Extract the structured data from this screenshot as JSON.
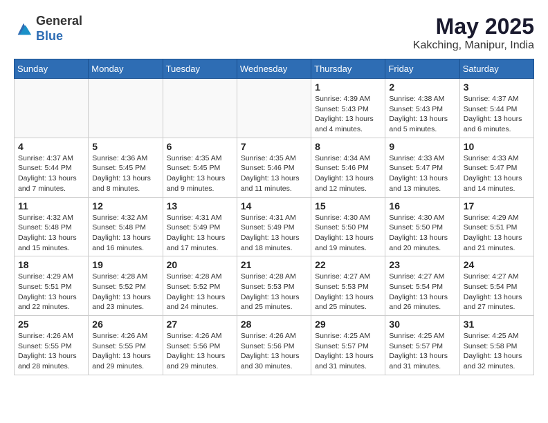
{
  "header": {
    "logo_general": "General",
    "logo_blue": "Blue",
    "month_year": "May 2025",
    "location": "Kakching, Manipur, India"
  },
  "weekdays": [
    "Sunday",
    "Monday",
    "Tuesday",
    "Wednesday",
    "Thursday",
    "Friday",
    "Saturday"
  ],
  "weeks": [
    [
      {
        "day": "",
        "info": ""
      },
      {
        "day": "",
        "info": ""
      },
      {
        "day": "",
        "info": ""
      },
      {
        "day": "",
        "info": ""
      },
      {
        "day": "1",
        "info": "Sunrise: 4:39 AM\nSunset: 5:43 PM\nDaylight: 13 hours and 4 minutes."
      },
      {
        "day": "2",
        "info": "Sunrise: 4:38 AM\nSunset: 5:43 PM\nDaylight: 13 hours and 5 minutes."
      },
      {
        "day": "3",
        "info": "Sunrise: 4:37 AM\nSunset: 5:44 PM\nDaylight: 13 hours and 6 minutes."
      }
    ],
    [
      {
        "day": "4",
        "info": "Sunrise: 4:37 AM\nSunset: 5:44 PM\nDaylight: 13 hours and 7 minutes."
      },
      {
        "day": "5",
        "info": "Sunrise: 4:36 AM\nSunset: 5:45 PM\nDaylight: 13 hours and 8 minutes."
      },
      {
        "day": "6",
        "info": "Sunrise: 4:35 AM\nSunset: 5:45 PM\nDaylight: 13 hours and 9 minutes."
      },
      {
        "day": "7",
        "info": "Sunrise: 4:35 AM\nSunset: 5:46 PM\nDaylight: 13 hours and 11 minutes."
      },
      {
        "day": "8",
        "info": "Sunrise: 4:34 AM\nSunset: 5:46 PM\nDaylight: 13 hours and 12 minutes."
      },
      {
        "day": "9",
        "info": "Sunrise: 4:33 AM\nSunset: 5:47 PM\nDaylight: 13 hours and 13 minutes."
      },
      {
        "day": "10",
        "info": "Sunrise: 4:33 AM\nSunset: 5:47 PM\nDaylight: 13 hours and 14 minutes."
      }
    ],
    [
      {
        "day": "11",
        "info": "Sunrise: 4:32 AM\nSunset: 5:48 PM\nDaylight: 13 hours and 15 minutes."
      },
      {
        "day": "12",
        "info": "Sunrise: 4:32 AM\nSunset: 5:48 PM\nDaylight: 13 hours and 16 minutes."
      },
      {
        "day": "13",
        "info": "Sunrise: 4:31 AM\nSunset: 5:49 PM\nDaylight: 13 hours and 17 minutes."
      },
      {
        "day": "14",
        "info": "Sunrise: 4:31 AM\nSunset: 5:49 PM\nDaylight: 13 hours and 18 minutes."
      },
      {
        "day": "15",
        "info": "Sunrise: 4:30 AM\nSunset: 5:50 PM\nDaylight: 13 hours and 19 minutes."
      },
      {
        "day": "16",
        "info": "Sunrise: 4:30 AM\nSunset: 5:50 PM\nDaylight: 13 hours and 20 minutes."
      },
      {
        "day": "17",
        "info": "Sunrise: 4:29 AM\nSunset: 5:51 PM\nDaylight: 13 hours and 21 minutes."
      }
    ],
    [
      {
        "day": "18",
        "info": "Sunrise: 4:29 AM\nSunset: 5:51 PM\nDaylight: 13 hours and 22 minutes."
      },
      {
        "day": "19",
        "info": "Sunrise: 4:28 AM\nSunset: 5:52 PM\nDaylight: 13 hours and 23 minutes."
      },
      {
        "day": "20",
        "info": "Sunrise: 4:28 AM\nSunset: 5:52 PM\nDaylight: 13 hours and 24 minutes."
      },
      {
        "day": "21",
        "info": "Sunrise: 4:28 AM\nSunset: 5:53 PM\nDaylight: 13 hours and 25 minutes."
      },
      {
        "day": "22",
        "info": "Sunrise: 4:27 AM\nSunset: 5:53 PM\nDaylight: 13 hours and 25 minutes."
      },
      {
        "day": "23",
        "info": "Sunrise: 4:27 AM\nSunset: 5:54 PM\nDaylight: 13 hours and 26 minutes."
      },
      {
        "day": "24",
        "info": "Sunrise: 4:27 AM\nSunset: 5:54 PM\nDaylight: 13 hours and 27 minutes."
      }
    ],
    [
      {
        "day": "25",
        "info": "Sunrise: 4:26 AM\nSunset: 5:55 PM\nDaylight: 13 hours and 28 minutes."
      },
      {
        "day": "26",
        "info": "Sunrise: 4:26 AM\nSunset: 5:55 PM\nDaylight: 13 hours and 29 minutes."
      },
      {
        "day": "27",
        "info": "Sunrise: 4:26 AM\nSunset: 5:56 PM\nDaylight: 13 hours and 29 minutes."
      },
      {
        "day": "28",
        "info": "Sunrise: 4:26 AM\nSunset: 5:56 PM\nDaylight: 13 hours and 30 minutes."
      },
      {
        "day": "29",
        "info": "Sunrise: 4:25 AM\nSunset: 5:57 PM\nDaylight: 13 hours and 31 minutes."
      },
      {
        "day": "30",
        "info": "Sunrise: 4:25 AM\nSunset: 5:57 PM\nDaylight: 13 hours and 31 minutes."
      },
      {
        "day": "31",
        "info": "Sunrise: 4:25 AM\nSunset: 5:58 PM\nDaylight: 13 hours and 32 minutes."
      }
    ]
  ]
}
